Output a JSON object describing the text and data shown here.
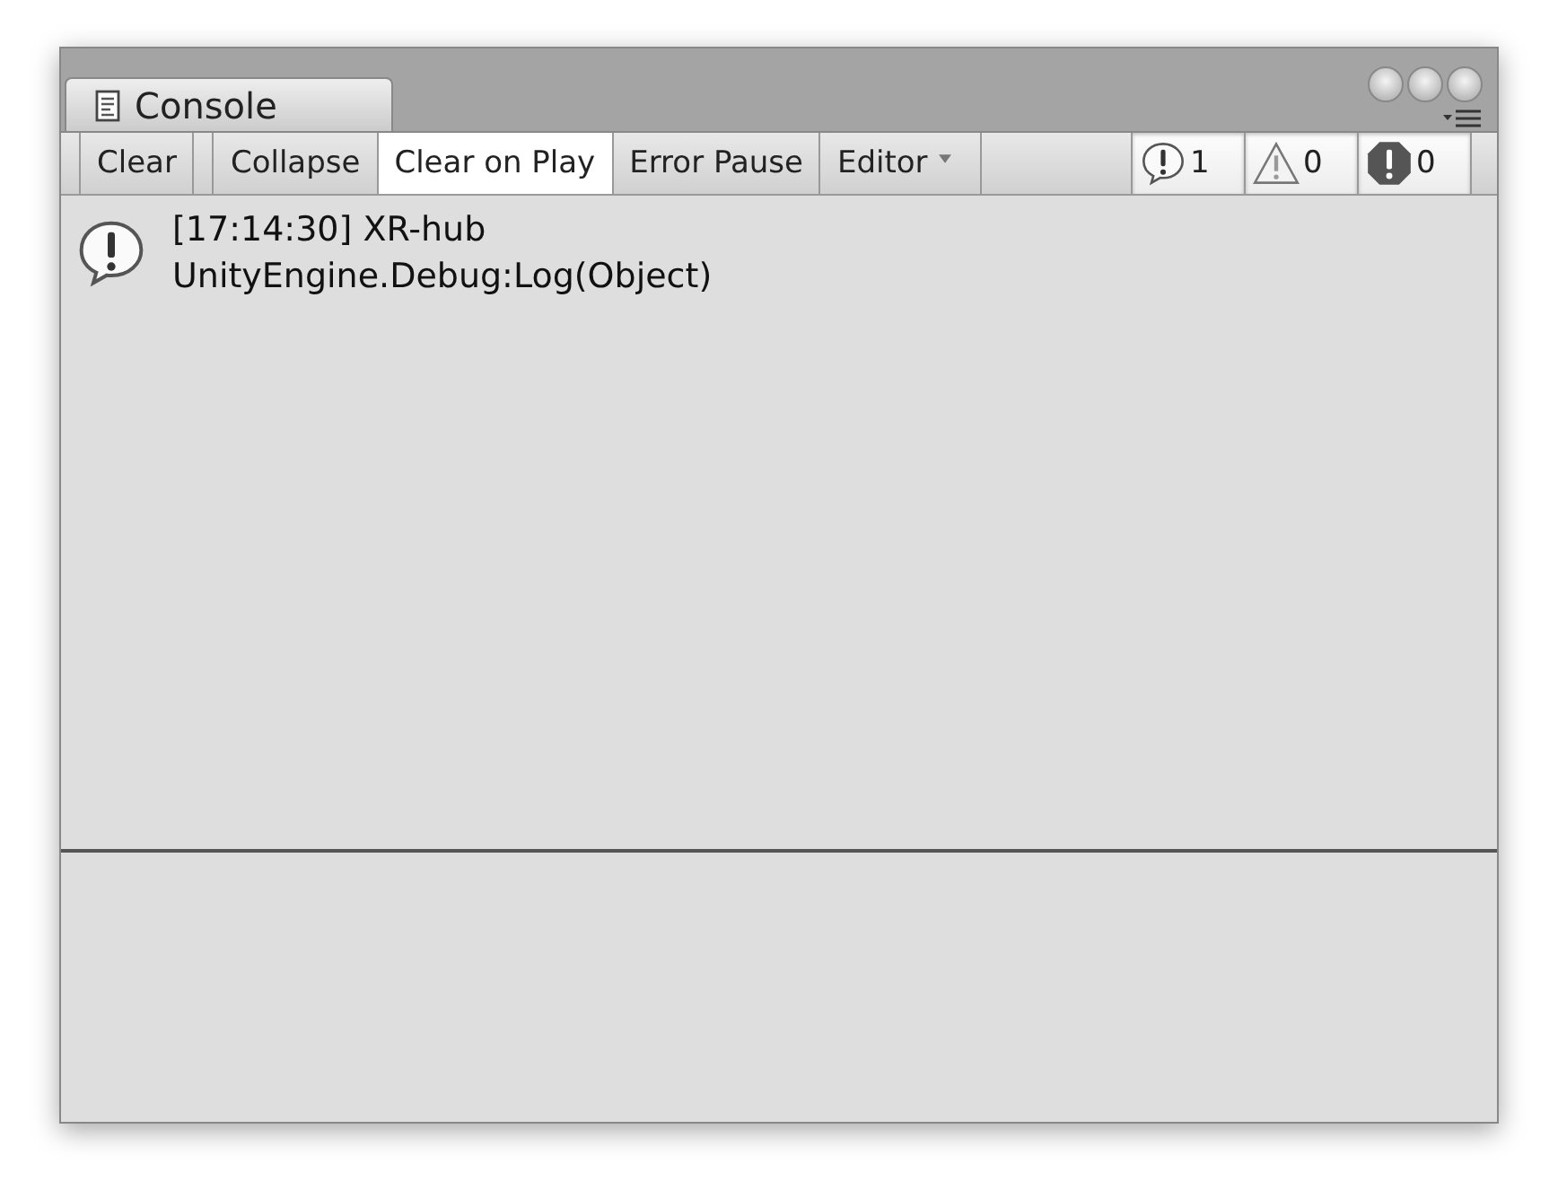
{
  "tab": {
    "title": "Console",
    "selected": true
  },
  "toolbar": [
    {
      "kind": "button",
      "label": "Clear"
    },
    {
      "kind": "toggle",
      "label": "Collapse",
      "selected": false
    },
    {
      "kind": "toggle",
      "label": "Clear on Play",
      "selected": true
    },
    {
      "kind": "toggle",
      "label": "Error Pause",
      "selected": false
    },
    {
      "kind": "dropdown",
      "label": "Editor"
    }
  ],
  "counters": [
    {
      "kind": "info",
      "count": "1",
      "selected": true
    },
    {
      "kind": "warning",
      "count": "0",
      "selected": true
    },
    {
      "kind": "error",
      "count": "0",
      "selected": true
    }
  ],
  "log_entries": [
    {
      "kind": "info",
      "lines": [
        "[17:14:30] XR-hub",
        "UnityEngine.Debug:Log(Object)"
      ]
    }
  ]
}
